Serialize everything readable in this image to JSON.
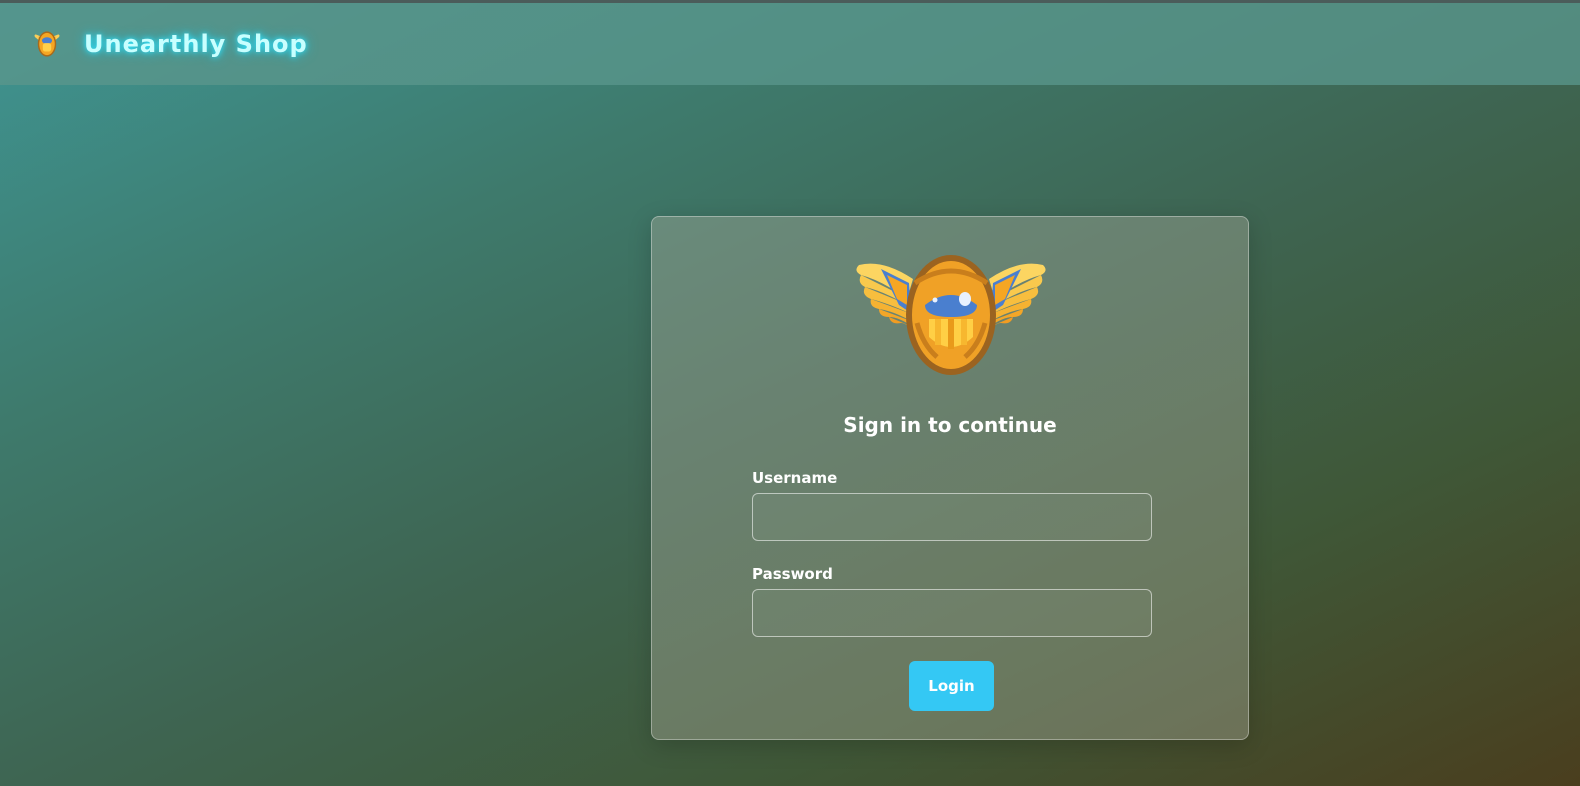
{
  "header": {
    "brand_name": "Unearthly Shop",
    "logo_icon": "scarab-icon"
  },
  "login": {
    "logo_icon": "scarab-icon",
    "title": "Sign in to continue",
    "username_label": "Username",
    "username_value": "",
    "password_label": "Password",
    "password_value": "",
    "login_button": "Login"
  },
  "colors": {
    "brand_glow": "#36e6ff",
    "button": "#34c8f4",
    "scarab_gold": "#f5b02e",
    "scarab_blue": "#4a7fcf"
  }
}
